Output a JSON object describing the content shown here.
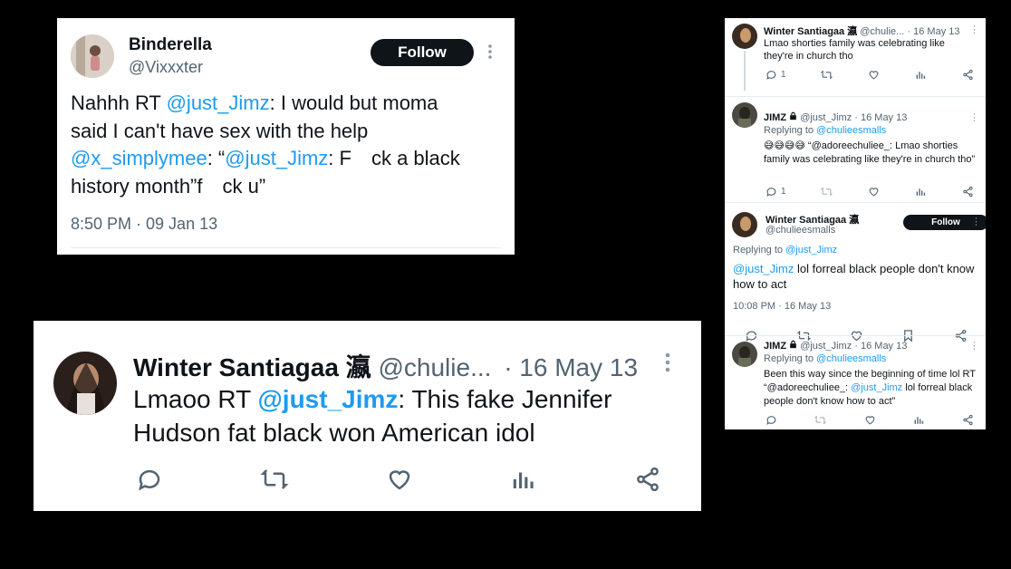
{
  "card1": {
    "name": "Binderella",
    "handle": "@Vixxxter",
    "follow_label": "Follow",
    "text_a": "Nahhh RT ",
    "mention_a": "@just_Jimz",
    "text_b": ": I would but moma",
    "text_c": "said I can't have sex with the help",
    "mention_b": "@x_simplymee",
    "text_d": ": “",
    "mention_c": "@just_Jimz",
    "text_e": ": F ck a black",
    "text_f": "history month”f ck u”",
    "timestamp": "8:50 PM · 09 Jan 13"
  },
  "card2": {
    "name": "Winter Santiagaa 瀛",
    "handle": "@chulie...",
    "date": "· 16 May 13",
    "text_a": "Lmaoo RT ",
    "mention_a": "@just_Jimz",
    "text_b": ": This fake Jennifer",
    "text_c": "Hudson fat black won American idol"
  },
  "thread": {
    "t1": {
      "name": "Winter Santiagaa 瀛",
      "handle": "@chulie...",
      "date": "· 16 May 13",
      "text": "Lmao shorties family was celebrating like they're in church tho",
      "reply_count": "1"
    },
    "t2": {
      "name": "JIMZ",
      "handle": "@just_Jimz",
      "date": "· 16 May 13",
      "replying_label": "Replying to ",
      "replying_to": "@chulieesmalls",
      "emoji": "😅😅😅😅",
      "text": " “@adoreechuliee_: Lmao shorties family was celebrating like they're in church tho”",
      "reply_count": "1"
    },
    "t3": {
      "name": "Winter Santiagaa 瀛",
      "handle": "@chulieesmalls",
      "follow_label": "Follow",
      "replying_label": "Replying to ",
      "replying_to": "@just_Jimz",
      "mention": "@just_Jimz",
      "text": " lol forreal black people don't know how to act",
      "timestamp": "10:08 PM · 16 May 13"
    },
    "t4": {
      "name": "JIMZ",
      "handle": "@just_Jimz",
      "date": "· 16 May 13",
      "replying_label": "Replying to ",
      "replying_to": "@chulieesmalls",
      "text_a": "Been this way since the beginning of time lol RT “@adoreechuliee_: ",
      "mention": "@just_Jimz",
      "text_b": " lol forreal black people don't know how to act”"
    }
  },
  "icons": [
    "reply-icon",
    "retweet-icon",
    "like-icon",
    "views-icon",
    "bookmark-icon",
    "share-icon",
    "lock-icon",
    "more-icon"
  ],
  "colors": {
    "background": "#000000",
    "card": "#ffffff",
    "mention": "#1d9bf0",
    "muted": "#536471",
    "follow_bg": "#0f1419"
  }
}
